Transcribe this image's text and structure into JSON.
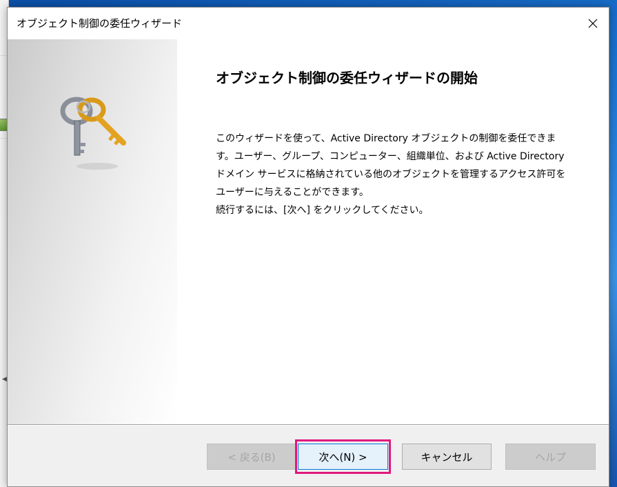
{
  "window": {
    "title": "オブジェクト制御の委任ウィザード"
  },
  "icons": {
    "close": "close-icon",
    "keys": "keys-icon"
  },
  "content": {
    "heading": "オブジェクト制御の委任ウィザードの開始",
    "description": "このウィザードを使って、Active Directory オブジェクトの制御を委任できます。ユーザー、グループ、コンピューター、組織単位、および Active Directory ドメイン サービスに格納されている他のオブジェクトを管理するアクセス許可をユーザーに与えることができます。",
    "instruction": "続行するには、[次へ] をクリックしてください。"
  },
  "buttons": {
    "back": "< 戻る(B)",
    "next": "次へ(N) >",
    "cancel": "キャンセル",
    "help": "ヘルプ"
  },
  "colors": {
    "highlight": "#e0197d",
    "focus_border": "#0078d7"
  }
}
